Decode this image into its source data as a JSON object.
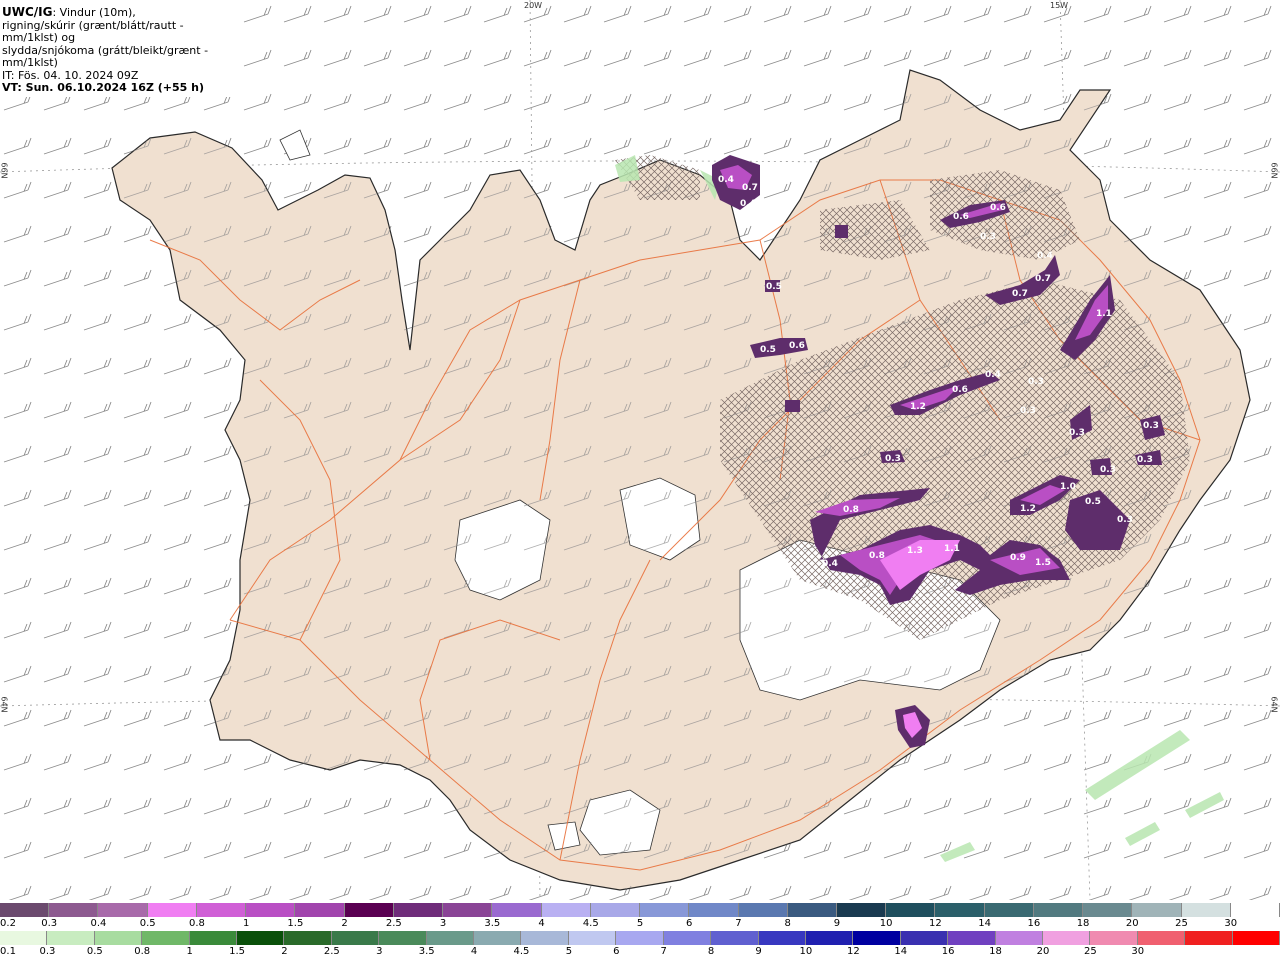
{
  "header": {
    "product": "UWC/IG",
    "line1_rest": ": Vindur (10m),",
    "line2": "rigning/skúrir (grænt/blátt/rautt - mm/1klst) og",
    "line3": "slydda/snjókoma (grátt/bleikt/grænt - mm/1klst)",
    "line4": "IT: Fös. 04. 10. 2024 09Z",
    "line5": "VT: Sun. 06.10.2024 16Z (+55 h)"
  },
  "graticule": {
    "top_left": "20W",
    "top_right": "15W",
    "left_upper": "66N",
    "left_lower": "64N",
    "right_upper": "66N",
    "right_lower": "64N"
  },
  "colors": {
    "land": "#f0e0d0",
    "sea": "#ffffff",
    "roads": "#e8703a",
    "snow_dark": "#5e2d6b",
    "snow_mid": "#b94fc4",
    "snow_light": "#f07ef2",
    "rain_green": "#b8e6b0"
  },
  "precip_labels": [
    {
      "t": "0.4"
    },
    {
      "t": "0.7"
    },
    {
      "t": "0.4"
    },
    {
      "t": "0.6"
    },
    {
      "t": "0.6"
    },
    {
      "t": "0.3"
    },
    {
      "t": "0.4"
    },
    {
      "t": "0.7"
    },
    {
      "t": "0.7"
    },
    {
      "t": "1.1"
    },
    {
      "t": "0.5"
    },
    {
      "t": "0.6"
    },
    {
      "t": "0.5"
    },
    {
      "t": "1.2"
    },
    {
      "t": "0.6"
    },
    {
      "t": "0.4"
    },
    {
      "t": "0.3"
    },
    {
      "t": "0.3"
    },
    {
      "t": "0.3"
    },
    {
      "t": "0.3"
    },
    {
      "t": "0.3"
    },
    {
      "t": "0.3"
    },
    {
      "t": "0.8"
    },
    {
      "t": "1.2"
    },
    {
      "t": "1.0"
    },
    {
      "t": "0.5"
    },
    {
      "t": "0.3"
    },
    {
      "t": "0.4"
    },
    {
      "t": "0.8"
    },
    {
      "t": "1.3"
    },
    {
      "t": "1.1"
    },
    {
      "t": "0.9"
    },
    {
      "t": "1.5"
    },
    {
      "t": "0.3"
    }
  ],
  "legend_snow": {
    "colors": [
      "#6b4a6e",
      "#8d5a90",
      "#a86aaa",
      "#f07ef2",
      "#d05fd6",
      "#b94fc4",
      "#a144ad",
      "#5a0052",
      "#6f2c7a",
      "#8a4496",
      "#9a6ad0",
      "#b9b0f2",
      "#a8a8e8",
      "#8898d8",
      "#7088c8",
      "#5a78b0",
      "#3a5a80",
      "#1a3a50",
      "#1f4f5e",
      "#2b5f6a",
      "#3a6a72",
      "#527a80",
      "#6a8a90",
      "#a0b4b8",
      "#d4e0e0",
      "#ffffff"
    ],
    "labels": [
      "0.2",
      "0.3",
      "0.4",
      "0.5",
      "0.8",
      "1",
      "1.5",
      "2",
      "2.5",
      "3",
      "3.5",
      "4",
      "4.5",
      "5",
      "6",
      "7",
      "8",
      "9",
      "10",
      "12",
      "14",
      "16",
      "18",
      "20",
      "25",
      "30"
    ]
  },
  "legend_rain": {
    "colors": [
      "#e8f8e0",
      "#c8ecc0",
      "#a8dca0",
      "#70b868",
      "#3a8a3a",
      "#0a500a",
      "#2a6a2a",
      "#3a7a4a",
      "#4a8a5a",
      "#6a9a8a",
      "#8aaab0",
      "#a8b8d8",
      "#c0c8f0",
      "#a8a8f0",
      "#8080e0",
      "#6060d0",
      "#3838c0",
      "#2020b0",
      "#0000a0",
      "#3a30b0",
      "#7040c0",
      "#c080e0",
      "#f0a0e0",
      "#f08ab0",
      "#f06070",
      "#f02020",
      "#ff0000"
    ],
    "labels": [
      "0.1",
      "0.3",
      "0.5",
      "0.8",
      "1",
      "1.5",
      "2",
      "2.5",
      "3",
      "3.5",
      "4",
      "4.5",
      "5",
      "6",
      "7",
      "8",
      "9",
      "10",
      "12",
      "14",
      "16",
      "18",
      "20",
      "25",
      "30"
    ]
  }
}
